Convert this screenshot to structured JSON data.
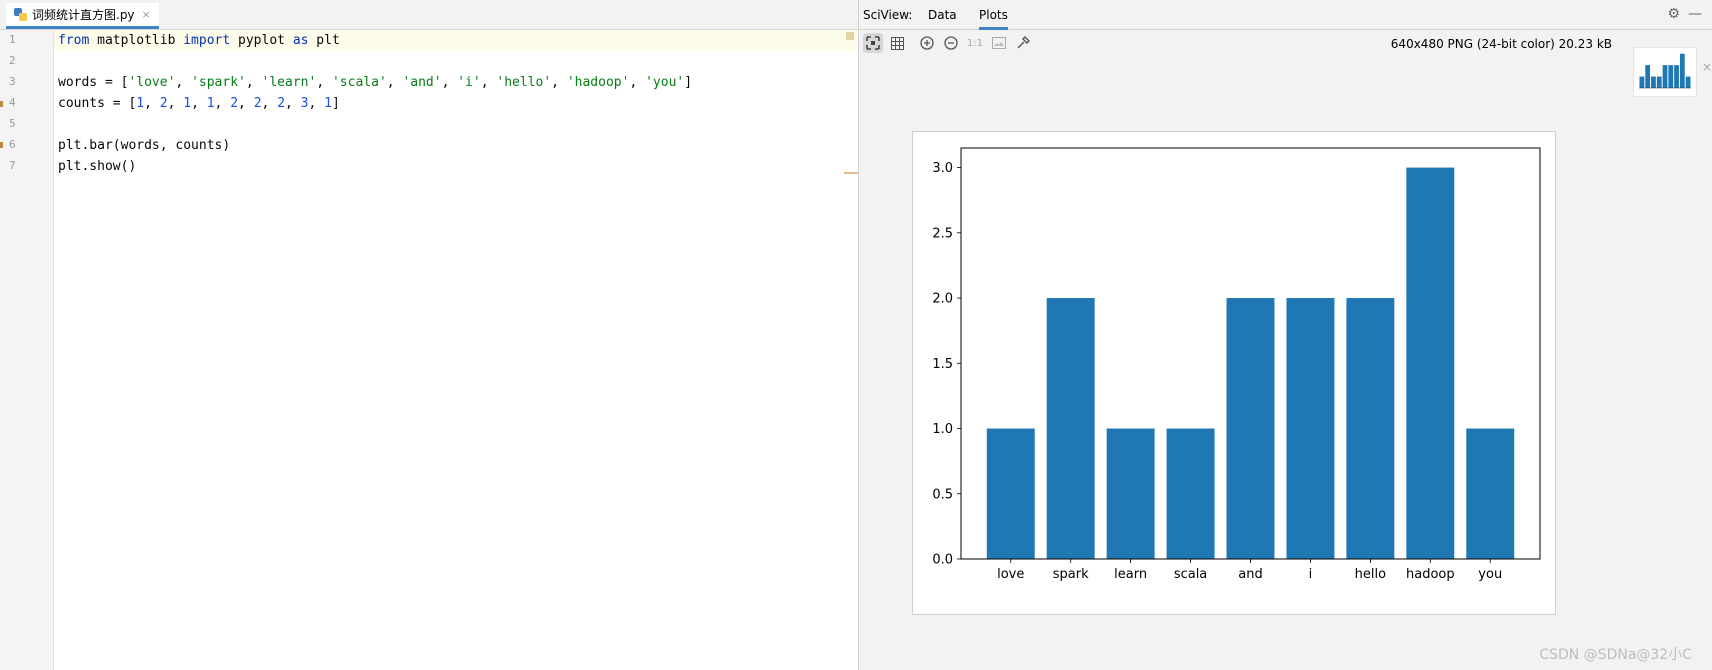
{
  "editor": {
    "tab": {
      "filename": "词频统计直方图.py",
      "close": "×"
    },
    "line_numbers": [
      "1",
      "2",
      "3",
      "4",
      "5",
      "6",
      "7"
    ],
    "code": {
      "line1": {
        "from": "from",
        "module": " matplotlib ",
        "import": "import",
        "mid": " pyplot ",
        "as": "as",
        "alias": " plt"
      },
      "line3": {
        "prefix": "words = [",
        "items": [
          "'love'",
          "'spark'",
          "'learn'",
          "'scala'",
          "'and'",
          "'i'",
          "'hello'",
          "'hadoop'",
          "'you'"
        ],
        "sep": ", ",
        "suffix": "]"
      },
      "line4": {
        "prefix": "counts = [",
        "items": [
          "1",
          "2",
          "1",
          "1",
          "2",
          "2",
          "2",
          "3",
          "1"
        ],
        "sep": ", ",
        "suffix": "]"
      },
      "line6": "plt.bar(words, counts)",
      "line7": "plt.show()"
    }
  },
  "sciview": {
    "title": "SciView:",
    "tabs": [
      "Data",
      "Plots"
    ],
    "active_tab": "Plots",
    "image_info": "640x480 PNG (24-bit color) 20.23 kB",
    "toolbar_icons": [
      "fit-icon",
      "grid-icon",
      "zoom-in-icon",
      "zoom-out-icon",
      "actual-size-icon",
      "background-icon",
      "color-picker-icon"
    ],
    "actual_size_label": "1:1"
  },
  "colors": {
    "bar": "#1f77b4",
    "accent": "#4083c9"
  },
  "chart_data": {
    "type": "bar",
    "categories": [
      "love",
      "spark",
      "learn",
      "scala",
      "and",
      "i",
      "hello",
      "hadoop",
      "you"
    ],
    "values": [
      1,
      2,
      1,
      1,
      2,
      2,
      2,
      3,
      1
    ],
    "title": "",
    "xlabel": "",
    "ylabel": "",
    "ylim": [
      0,
      3.15
    ],
    "yticks": [
      "0.0",
      "0.5",
      "1.0",
      "1.5",
      "2.0",
      "2.5",
      "3.0"
    ],
    "grid": false
  },
  "watermark": "CSDN @SDNa@32小C"
}
